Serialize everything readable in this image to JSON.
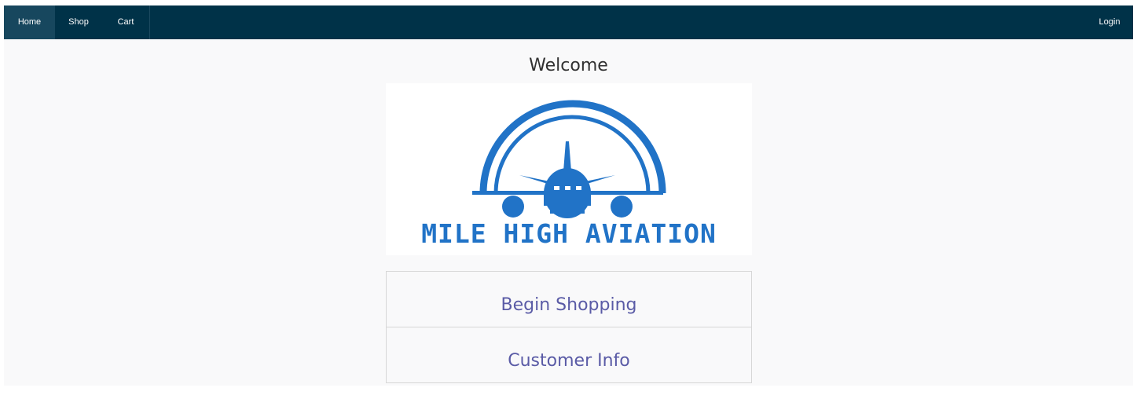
{
  "nav": {
    "items": [
      {
        "label": "Home",
        "active": true
      },
      {
        "label": "Shop",
        "active": false
      },
      {
        "label": "Cart",
        "active": false
      }
    ],
    "login_label": "Login"
  },
  "main": {
    "welcome": "Welcome",
    "logo": {
      "text": "MILE HIGH AVIATION",
      "icon": "airplane-logo-icon",
      "color": "#2173c7"
    },
    "menu": [
      {
        "label": "Begin Shopping"
      },
      {
        "label": "Customer Info"
      }
    ]
  },
  "colors": {
    "navbar": "#003248",
    "nav_active": "#17475e",
    "link": "#5a5ba6",
    "background": "#f9f9fa"
  }
}
